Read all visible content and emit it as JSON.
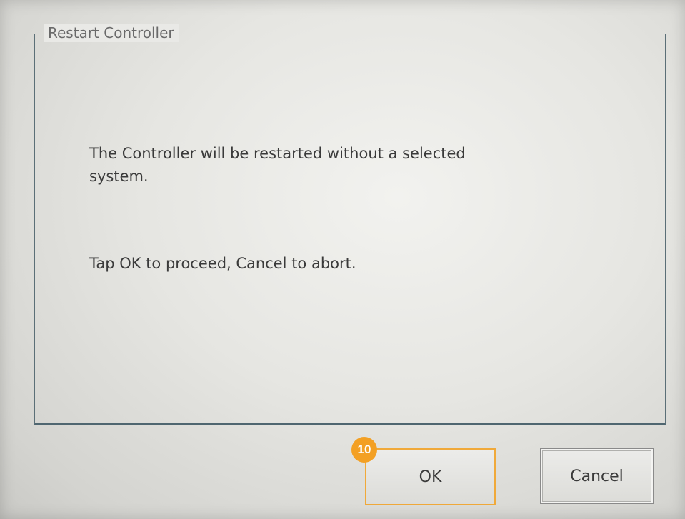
{
  "dialog": {
    "title": "Restart Controller",
    "message_line1": "The Controller will be restarted without a selected",
    "message_line2": "system.",
    "message_line3": "Tap OK to proceed, Cancel to abort."
  },
  "buttons": {
    "ok_label": "OK",
    "cancel_label": "Cancel"
  },
  "annotation": {
    "step_number": "10"
  },
  "colors": {
    "highlight": "#f0a93a",
    "badge": "#f3a024",
    "frame": "#5b6f77"
  }
}
